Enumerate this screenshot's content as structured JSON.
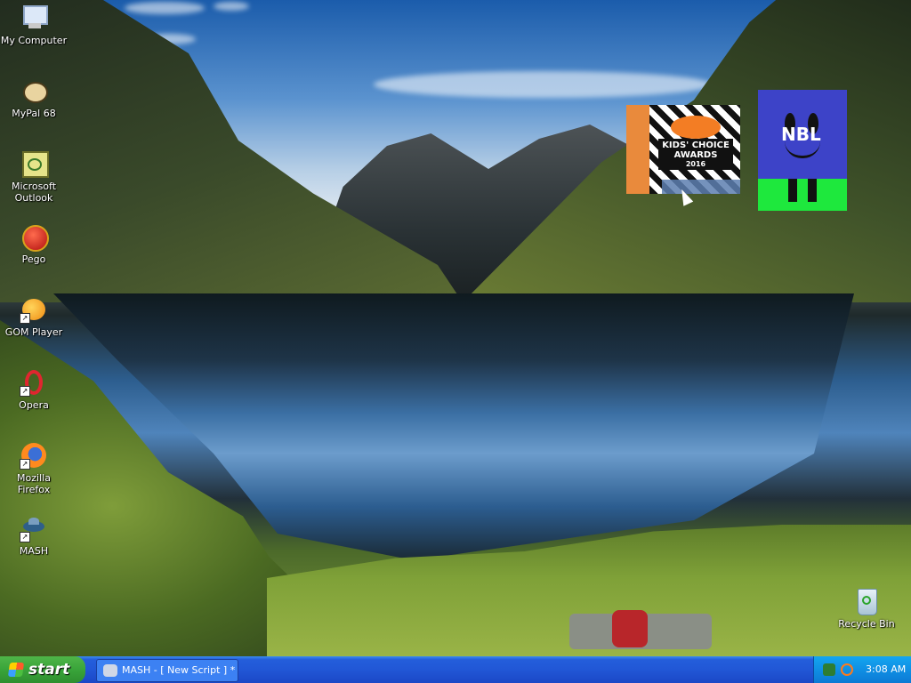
{
  "desktop": {
    "icons": [
      {
        "label": "My Computer",
        "icon": "computer-icon"
      },
      {
        "label": "MyPal 68",
        "icon": "mypal-icon"
      },
      {
        "label": "Microsoft Outlook",
        "icon": "outlook-icon"
      },
      {
        "label": "Pego",
        "icon": "pego-icon"
      },
      {
        "label": "GOM Player",
        "icon": "gom-player-icon"
      },
      {
        "label": "Opera",
        "icon": "opera-icon"
      },
      {
        "label": "Mozilla Firefox",
        "icon": "firefox-icon"
      },
      {
        "label": "MASH",
        "icon": "mash-icon"
      },
      {
        "label": "Recycle Bin",
        "icon": "recycle-bin-icon"
      }
    ],
    "kca_image": {
      "line1": "KIDS' CHOICE",
      "line2": "AWARDS",
      "year": "2016"
    },
    "nbl_image": {
      "logo": "NBL"
    }
  },
  "taskbar": {
    "start_label": "start",
    "task_label": "MASH - [ New Script ] *",
    "clock": "3:08 AM"
  },
  "colors": {
    "taskbar_blue": "#245edb",
    "start_green": "#39a43a",
    "tray_blue": "#0f8fe4"
  }
}
